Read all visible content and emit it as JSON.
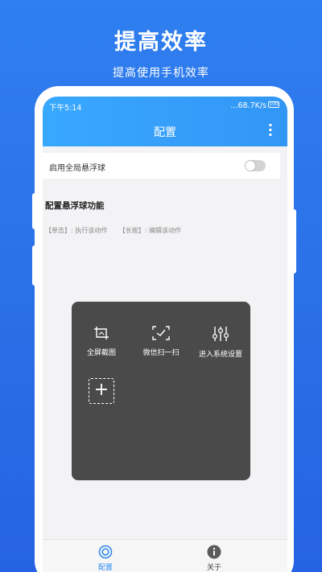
{
  "promo": {
    "headline": "提高效率",
    "subline": "提高使用手机效率"
  },
  "status_bar": {
    "time": "下午5:14",
    "network": "...68.7K/s",
    "battery": "100"
  },
  "app_bar": {
    "title": "配置",
    "more_icon": "more-vertical-icon"
  },
  "settings": {
    "floating_ball_toggle_label": "启用全局悬浮球",
    "floating_ball_enabled": false,
    "section_title": "配置悬浮球功能",
    "hint_click": "【单击】: 执行该动作",
    "hint_long_press": "【长按】: 编辑该动作"
  },
  "floating_panel": {
    "items": [
      {
        "label": "全屏截图",
        "icon": "screenshot-icon"
      },
      {
        "label": "微信扫一扫",
        "icon": "scan-icon"
      },
      {
        "label": "进入系统设置",
        "icon": "sliders-icon"
      }
    ],
    "add_label": "+"
  },
  "bottom_nav": {
    "items": [
      {
        "label": "配置",
        "icon": "config-ring-icon",
        "active": true
      },
      {
        "label": "关于",
        "icon": "info-icon",
        "active": false
      }
    ]
  },
  "colors": {
    "background": "#2a6fe6",
    "app_bar": "#39a8ff",
    "accent": "#2f8af2",
    "panel": "#4a4a4a"
  }
}
